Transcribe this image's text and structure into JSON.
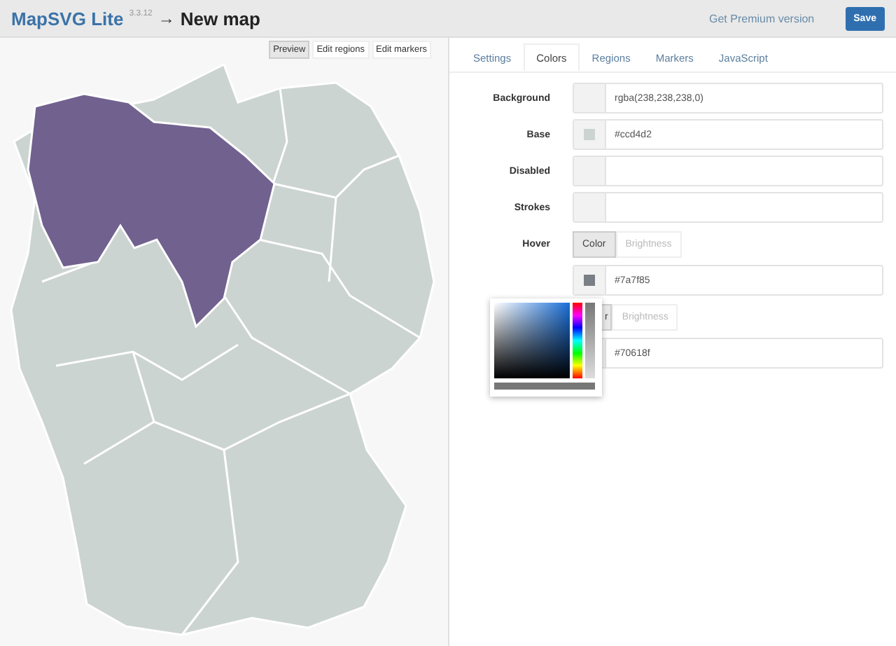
{
  "header": {
    "title": "MapSVG Lite",
    "version": "3.3.12",
    "arrow": "→",
    "map_name": "New map",
    "premium_link": "Get Premium version",
    "save_button": "Save"
  },
  "map_modes": [
    {
      "label": "Preview",
      "selected": true
    },
    {
      "label": "Edit regions",
      "selected": false
    },
    {
      "label": "Edit markers",
      "selected": false
    }
  ],
  "tabs": [
    {
      "label": "Settings",
      "selected": false
    },
    {
      "label": "Colors",
      "selected": true
    },
    {
      "label": "Regions",
      "selected": false
    },
    {
      "label": "Markers",
      "selected": false
    },
    {
      "label": "JavaScript",
      "selected": false
    }
  ],
  "rows": [
    {
      "kind": "color",
      "label": "Background",
      "value": "rgba(238,238,238,0)"
    },
    {
      "kind": "color",
      "label": "Base",
      "value": "#ccd4d2",
      "swatch": true
    },
    {
      "kind": "color",
      "label": "Disabled"
    },
    {
      "kind": "color",
      "label": "Strokes"
    },
    {
      "kind": "toggle",
      "label": "Hover",
      "options": [
        {
          "label": "Color",
          "selected": true
        },
        {
          "label": "Brightness",
          "selected": false
        }
      ]
    },
    {
      "kind": "color",
      "value": "#7a7f85",
      "swatch": true
    },
    {
      "kind": "toggle",
      "options": [
        {
          "label": "r",
          "selected": true
        },
        {
          "label": "Brightness",
          "selected": false
        }
      ]
    },
    {
      "kind": "color",
      "value": "#70618f"
    }
  ]
}
